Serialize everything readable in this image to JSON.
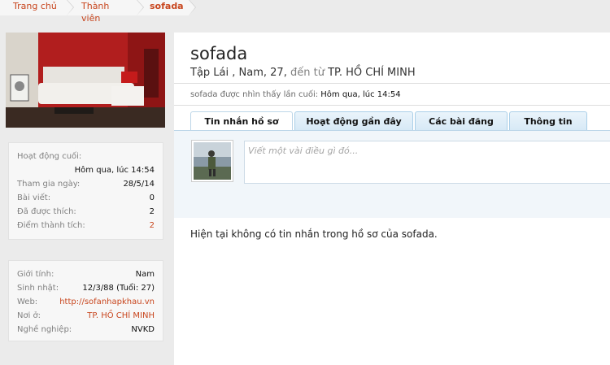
{
  "breadcrumb": [
    {
      "label": "Trang chủ"
    },
    {
      "label": "Thành viên"
    },
    {
      "label": "sofada"
    }
  ],
  "profile": {
    "username": "sofada",
    "title": "Tập Lái",
    "gender_age": "Nam, 27,",
    "from_label": "đến từ",
    "location": "TP. HỒ CHÍ MINH",
    "last_seen_label": "sofada được nhìn thấy lần cuối:",
    "last_seen_value": "Hôm qua, lúc 14:54"
  },
  "tabs": [
    {
      "label": "Tin nhắn hồ sơ",
      "active": true
    },
    {
      "label": "Hoạt động gần đây",
      "active": false
    },
    {
      "label": "Các bài đăng",
      "active": false
    },
    {
      "label": "Thông tin",
      "active": false
    }
  ],
  "composer": {
    "placeholder": "Viết một vài điều gì đó..."
  },
  "empty_message": "Hiện tại không có tin nhắn trong hồ sơ của sofada.",
  "stats": {
    "last_activity_label": "Hoạt động cuối:",
    "last_activity_value": "Hôm qua, lúc 14:54",
    "joined_label": "Tham gia ngày:",
    "joined_value": "28/5/14",
    "posts_label": "Bài viết:",
    "posts_value": "0",
    "likes_label": "Đã được thích:",
    "likes_value": "2",
    "points_label": "Điểm thành tích:",
    "points_value": "2"
  },
  "info": {
    "gender_label": "Giới tính:",
    "gender_value": "Nam",
    "birthday_label": "Sinh nhật:",
    "birthday_value": "12/3/88 (Tuổi: 27)",
    "web_label": "Web:",
    "web_value": "http://sofanhapkhau.vn",
    "location_label": "Nơi ở:",
    "location_value": "TP. HỒ CHÍ MINH",
    "job_label": "Nghề nghiệp:",
    "job_value": "NVKD"
  },
  "colors": {
    "accent": "#c8461e",
    "tab_border": "#aacfe8",
    "composer_bg": "#f1f6fa"
  }
}
